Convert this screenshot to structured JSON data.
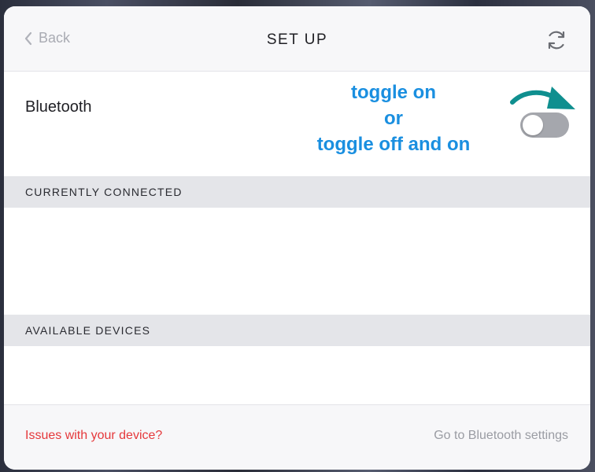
{
  "header": {
    "back_label": "Back",
    "title": "SET UP"
  },
  "bluetooth": {
    "label": "Bluetooth",
    "toggle_state": "off"
  },
  "annotation": {
    "line1": "toggle on",
    "line2": "or",
    "line3": "toggle off and on",
    "color": "#1a8fe0",
    "arrow_color": "#0f8f8f"
  },
  "sections": {
    "connected_title": "CURRENTLY CONNECTED",
    "available_title": "AVAILABLE DEVICES"
  },
  "footer": {
    "issues_label": "Issues with your device?",
    "settings_label": "Go to Bluetooth settings"
  }
}
